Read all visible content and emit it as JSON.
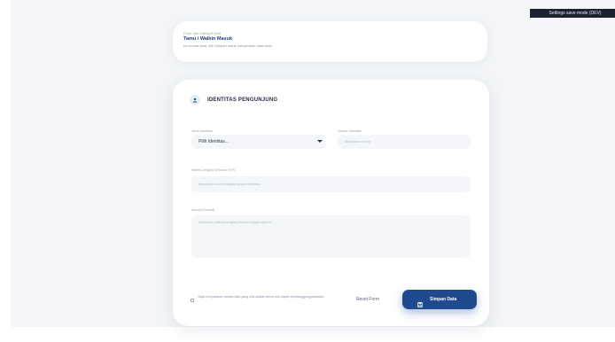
{
  "badge": {
    "text": "Settings save mode (DEV)"
  },
  "meta": {
    "label": "Form dan Kategori Aktif",
    "value": "Tamu / Walkin Masuk",
    "subtext": "Isi semua data, klik Simpan untuk menyimpan data tamu."
  },
  "section": {
    "title": "IDENTITAS PENGUNJUNG",
    "icon": "user-icon"
  },
  "fields": {
    "jenis_identitas": {
      "label": "Jenis Identitas",
      "value": "Pilih Identitas..."
    },
    "nomor_identitas": {
      "label": "Nomor Identitas",
      "placeholder": "Masukkan nomor"
    },
    "nama_lengkap": {
      "label": "Nama Lengkap (Sesuai KTP)",
      "placeholder": "Masukkan nama lengkap sesuai identitas"
    },
    "alamat": {
      "label": "Alamat Domisili",
      "placeholder": "Masukkan alamat lengkap tempat tinggal saat ini"
    }
  },
  "consent": {
    "text": "Saya menyatakan bahwa data yang diisi adalah benar dan dapat dipertanggungjawabkan."
  },
  "actions": {
    "reset_label": "Reset Form",
    "save_label": "Simpan Data",
    "save_icon": "save-icon"
  },
  "colors": {
    "primary": "#1f4b8e",
    "page_bg": "#f3f5f8",
    "card_bg": "#ffffff",
    "input_bg": "#f4f6f9"
  }
}
